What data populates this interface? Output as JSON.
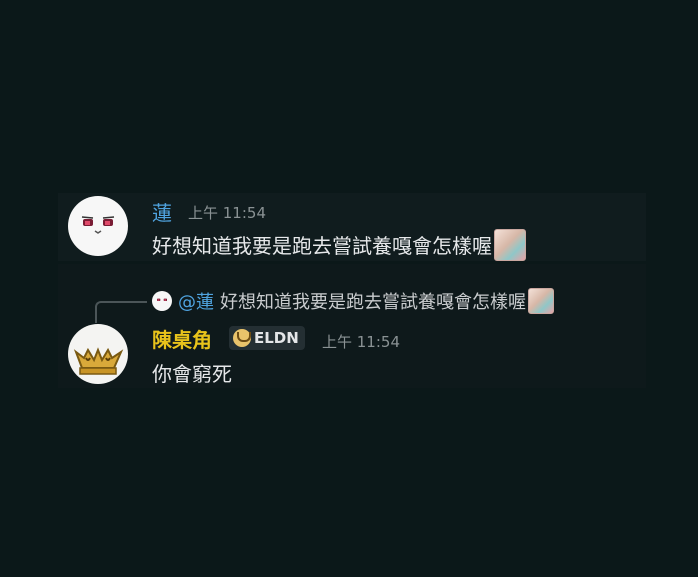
{
  "messages": [
    {
      "author": "蓮",
      "time": "上午 11:54",
      "content": "好想知道我要是跑去嘗試養嘎會怎樣喔",
      "author_color": "#4fa3df"
    },
    {
      "author": "陳桌角",
      "badge": "ELDN",
      "time": "上午 11:54",
      "content": "你會窮死",
      "author_color": "#e8c31b",
      "reply": {
        "mention": "@蓮",
        "text": "好想知道我要是跑去嘗試養嘎會怎樣喔"
      }
    }
  ],
  "icons": {
    "avatar_1": "face-avatar-icon",
    "avatar_2": "crown-avatar-icon",
    "emoji": "custom-emoji-icon",
    "badge": "eldn-badge-icon"
  },
  "colors": {
    "background": "#0b1819",
    "mention": "#4fa3df",
    "role_gold": "#e8c31b"
  }
}
